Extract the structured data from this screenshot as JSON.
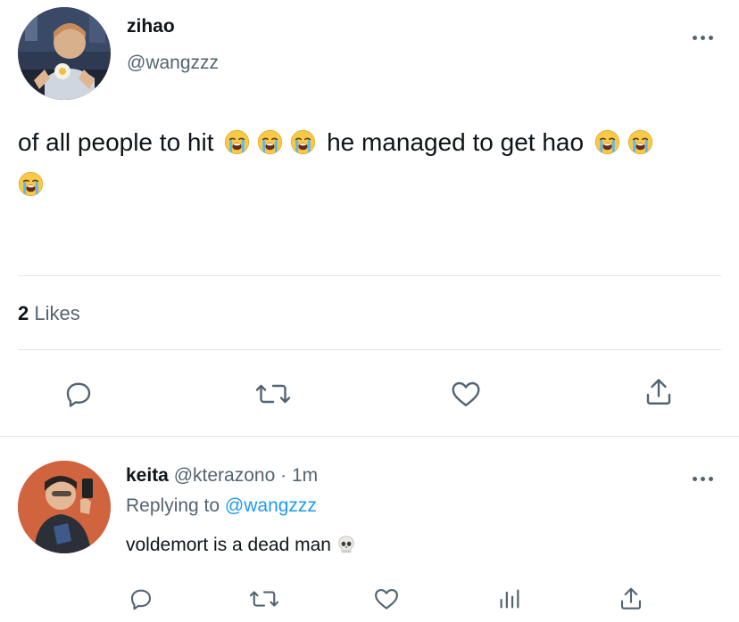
{
  "main_tweet": {
    "display_name": "zihao",
    "handle": "@wangzzz",
    "text_part1": "of all people to hit",
    "text_part2": "he managed to get hao",
    "emojis": [
      "loudly-crying-face",
      "loudly-crying-face",
      "loudly-crying-face",
      "loudly-crying-face",
      "loudly-crying-face",
      "loudly-crying-face"
    ],
    "likes_count": "2",
    "likes_label": "Likes",
    "actions": [
      "reply-icon",
      "retweet-icon",
      "like-icon",
      "share-icon"
    ]
  },
  "reply_tweet": {
    "display_name": "keita",
    "handle": "@kterazono",
    "separator": "·",
    "time": "1m",
    "replying_label": "Replying to",
    "replying_to": "@wangzzz",
    "text": "voldemort is a dead man",
    "emoji": "skull",
    "actions": [
      "reply-icon",
      "retweet-icon",
      "like-icon",
      "analytics-icon",
      "share-icon"
    ]
  },
  "colors": {
    "text_primary": "#0f1419",
    "text_secondary": "#536471",
    "accent": "#1d9bf0",
    "divider": "#e1e6ea"
  }
}
